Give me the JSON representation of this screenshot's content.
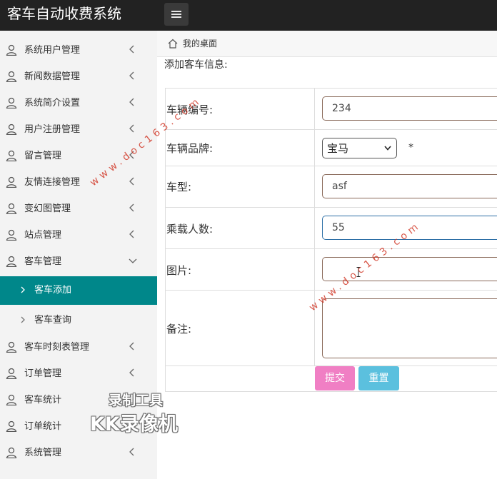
{
  "app": {
    "title": "客车自动收费系统",
    "menu_toggle_icon": "hamburger-icon"
  },
  "sidebar": {
    "items": [
      {
        "label": "系统用户管理",
        "icon": "user-icon",
        "chevron": "chevron-left-icon"
      },
      {
        "label": "新闻数据管理",
        "icon": "user-icon",
        "chevron": "chevron-left-icon"
      },
      {
        "label": "系统简介设置",
        "icon": "user-icon",
        "chevron": "chevron-left-icon"
      },
      {
        "label": "用户注册管理",
        "icon": "user-icon",
        "chevron": "chevron-left-icon"
      },
      {
        "label": "留言管理",
        "icon": "user-icon",
        "chevron": "chevron-left-icon"
      },
      {
        "label": "友情连接管理",
        "icon": "user-icon",
        "chevron": "chevron-left-icon"
      },
      {
        "label": "变幻图管理",
        "icon": "user-icon",
        "chevron": "chevron-left-icon"
      },
      {
        "label": "站点管理",
        "icon": "user-icon",
        "chevron": "chevron-left-icon"
      },
      {
        "label": "客车管理",
        "icon": "user-icon",
        "chevron": "chevron-down-icon",
        "expanded": true
      }
    ],
    "subitems": [
      {
        "label": "客车添加",
        "active": true
      },
      {
        "label": "客车查询",
        "active": false
      }
    ],
    "items_after": [
      {
        "label": "客车时刻表管理",
        "icon": "user-icon",
        "chevron": "chevron-left-icon"
      },
      {
        "label": "订单管理",
        "icon": "user-icon",
        "chevron": "chevron-left-icon"
      },
      {
        "label": "客车统计",
        "icon": "user-icon"
      },
      {
        "label": "订单统计",
        "icon": "user-icon"
      },
      {
        "label": "系统管理",
        "icon": "user-icon",
        "chevron": "chevron-left-icon"
      }
    ]
  },
  "breadcrumb": {
    "icon": "home-icon",
    "text": "我的桌面"
  },
  "form": {
    "heading": "添加客车信息:",
    "fields": {
      "vehicle_no": {
        "label": "车辆编号:",
        "value": "234"
      },
      "brand": {
        "label": "车辆品牌:",
        "value": "宝马",
        "required_mark": "*"
      },
      "model": {
        "label": "车型:",
        "value": "asf"
      },
      "capacity": {
        "label": "乘载人数:",
        "value": "55"
      },
      "image": {
        "label": "图片:",
        "value": ""
      },
      "remark": {
        "label": "备注:",
        "value": ""
      }
    },
    "submit_label": "提交",
    "reset_label": "重置"
  },
  "overlays": {
    "watermark_site": "www.doc163.com",
    "recorder_line1": "录制工具",
    "recorder_line2": "KK录像机"
  },
  "colors": {
    "topbar": "#222222",
    "sidebar_bg": "#f3f3f3",
    "active_item": "#00878a",
    "submit": "#f07fc4",
    "reset": "#5bc0de",
    "watermark": "#d23a2a"
  }
}
